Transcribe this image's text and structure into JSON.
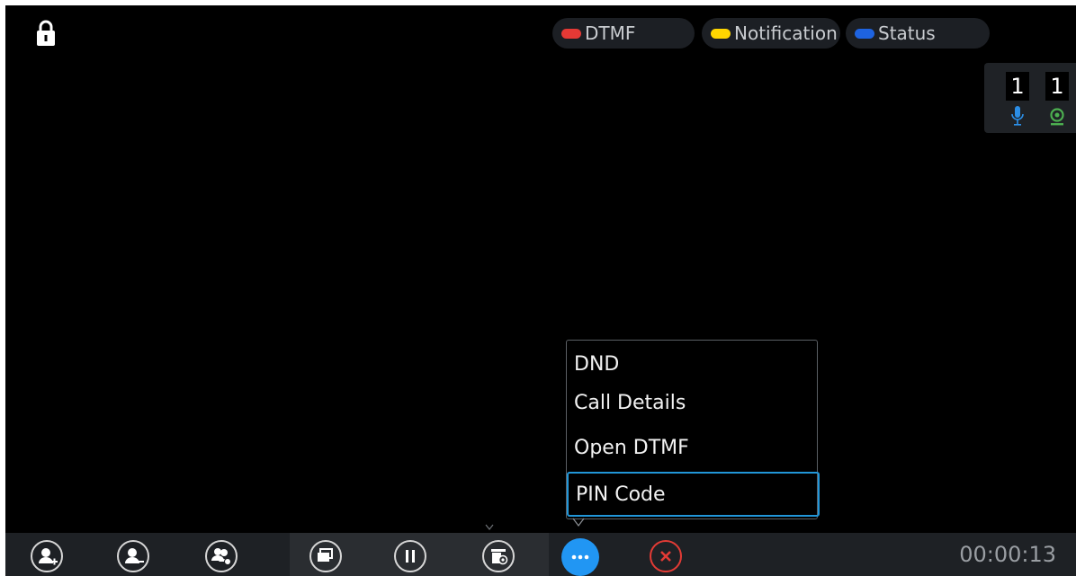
{
  "status_pills": [
    {
      "label": "DTMF",
      "color": "#e53935"
    },
    {
      "label": "Notification",
      "color": "#ffd600"
    },
    {
      "label": "Status",
      "color": "#1e63e0"
    }
  ],
  "counters": {
    "audio_count": "1",
    "video_count": "1",
    "audio_icon": "mic-icon",
    "video_icon": "webcam-icon"
  },
  "menu": {
    "items": [
      "DND",
      "Call Details",
      "Open DTMF",
      "PIN Code"
    ],
    "selected": "PIN Code",
    "accent": "#2196d8"
  },
  "toolbar": {
    "buttons": [
      {
        "icon": "add-participant-icon"
      },
      {
        "icon": "remove-participant-icon"
      },
      {
        "icon": "manage-participants-icon"
      },
      {
        "icon": "layout-icon"
      },
      {
        "icon": "hold-icon"
      },
      {
        "icon": "record-icon"
      },
      {
        "icon": "more-icon"
      },
      {
        "icon": "end-call-icon"
      }
    ],
    "timer": "00:00:13"
  }
}
